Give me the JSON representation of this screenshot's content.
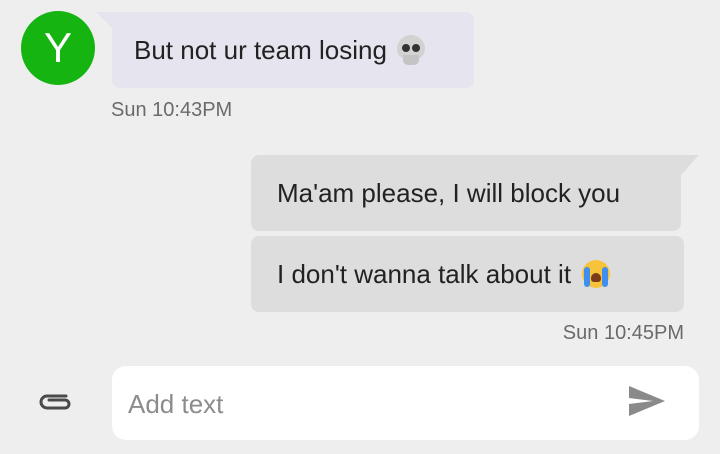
{
  "contact": {
    "avatar_letter": "Y",
    "avatar_color": "#16b410"
  },
  "messages": [
    {
      "direction": "incoming",
      "text": "But not ur team losing",
      "emoji": "skull-emoji"
    },
    {
      "direction": "outgoing",
      "text": "Ma'am please, I will block you"
    },
    {
      "direction": "outgoing",
      "text": "I don't wanna talk about it",
      "emoji": "loudly-crying-face-emoji"
    }
  ],
  "timestamps": {
    "incoming": "Sun 10:43PM",
    "outgoing": "Sun 10:45PM"
  },
  "compose": {
    "placeholder": "Add text",
    "value": ""
  },
  "icons": {
    "attach": "paperclip-icon",
    "send": "send-icon"
  }
}
